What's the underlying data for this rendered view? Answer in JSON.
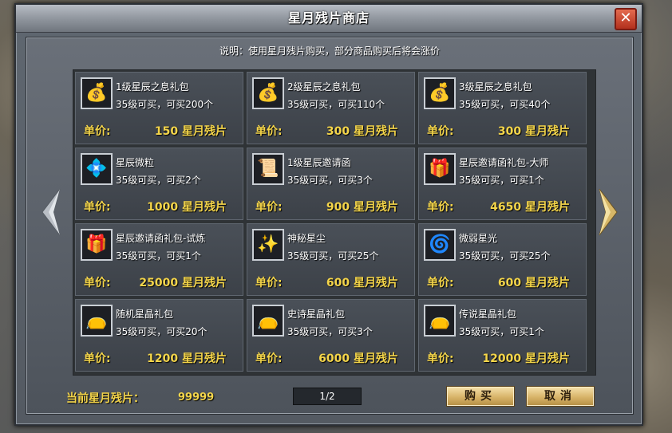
{
  "window": {
    "title": "星月残片商店",
    "close_glyph": "✕"
  },
  "notice": "说明：使用星月残片购买，部分商品购买后将会涨价",
  "price_label": "单价:",
  "items": [
    {
      "name": "1级星辰之息礼包",
      "limit": "35级可买，可买200个",
      "price": "150 星月残片",
      "icon": "gold-bag-icon",
      "glyph": "💰"
    },
    {
      "name": "2级星辰之息礼包",
      "limit": "35级可买，可买110个",
      "price": "300 星月残片",
      "icon": "gold-bag-icon",
      "glyph": "💰"
    },
    {
      "name": "3级星辰之息礼包",
      "limit": "35级可买，可买40个",
      "price": "300 星月残片",
      "icon": "gold-bag-icon",
      "glyph": "💰"
    },
    {
      "name": "星辰微粒",
      "limit": "35级可买，可买2个",
      "price": "1000 星月残片",
      "icon": "blue-crystal-icon",
      "glyph": "💠"
    },
    {
      "name": "1级星辰邀请函",
      "limit": "35级可买，可买3个",
      "price": "900 星月残片",
      "icon": "invitation-scroll-icon",
      "glyph": "📜"
    },
    {
      "name": "星辰邀请函礼包-大师",
      "limit": "35级可买，可买1个",
      "price": "4650 星月残片",
      "icon": "red-gift-box-icon",
      "glyph": "🎁"
    },
    {
      "name": "星辰邀请函礼包-试炼",
      "limit": "35级可买，可买1个",
      "price": "25000 星月残片",
      "icon": "red-gift-box-icon",
      "glyph": "🎁"
    },
    {
      "name": "神秘星尘",
      "limit": "35级可买，可买25个",
      "price": "600 星月残片",
      "icon": "blue-star-dust-icon",
      "glyph": "✨"
    },
    {
      "name": "微弱星光",
      "limit": "35级可买，可买25个",
      "price": "600 星月残片",
      "icon": "golden-swirl-icon",
      "glyph": "🌀"
    },
    {
      "name": "随机星晶礼包",
      "limit": "35级可买，可买20个",
      "price": "1200 星月残片",
      "icon": "crystal-pouch-icon",
      "glyph": "👝"
    },
    {
      "name": "史诗星晶礼包",
      "limit": "35级可买，可买3个",
      "price": "6000 星月残片",
      "icon": "crystal-pouch-icon",
      "glyph": "👝"
    },
    {
      "name": "传说星晶礼包",
      "limit": "35级可买，可买1个",
      "price": "12000 星月残片",
      "icon": "crystal-pouch-icon",
      "glyph": "👝"
    }
  ],
  "footer": {
    "balance_label": "当前星月残片：",
    "balance_value": "99999",
    "page": "1/2",
    "buy_label": "购买",
    "cancel_label": "取消"
  },
  "colors": {
    "price": "#f4d54a",
    "panel": "#3c4148",
    "title_text": "#ffffff"
  }
}
